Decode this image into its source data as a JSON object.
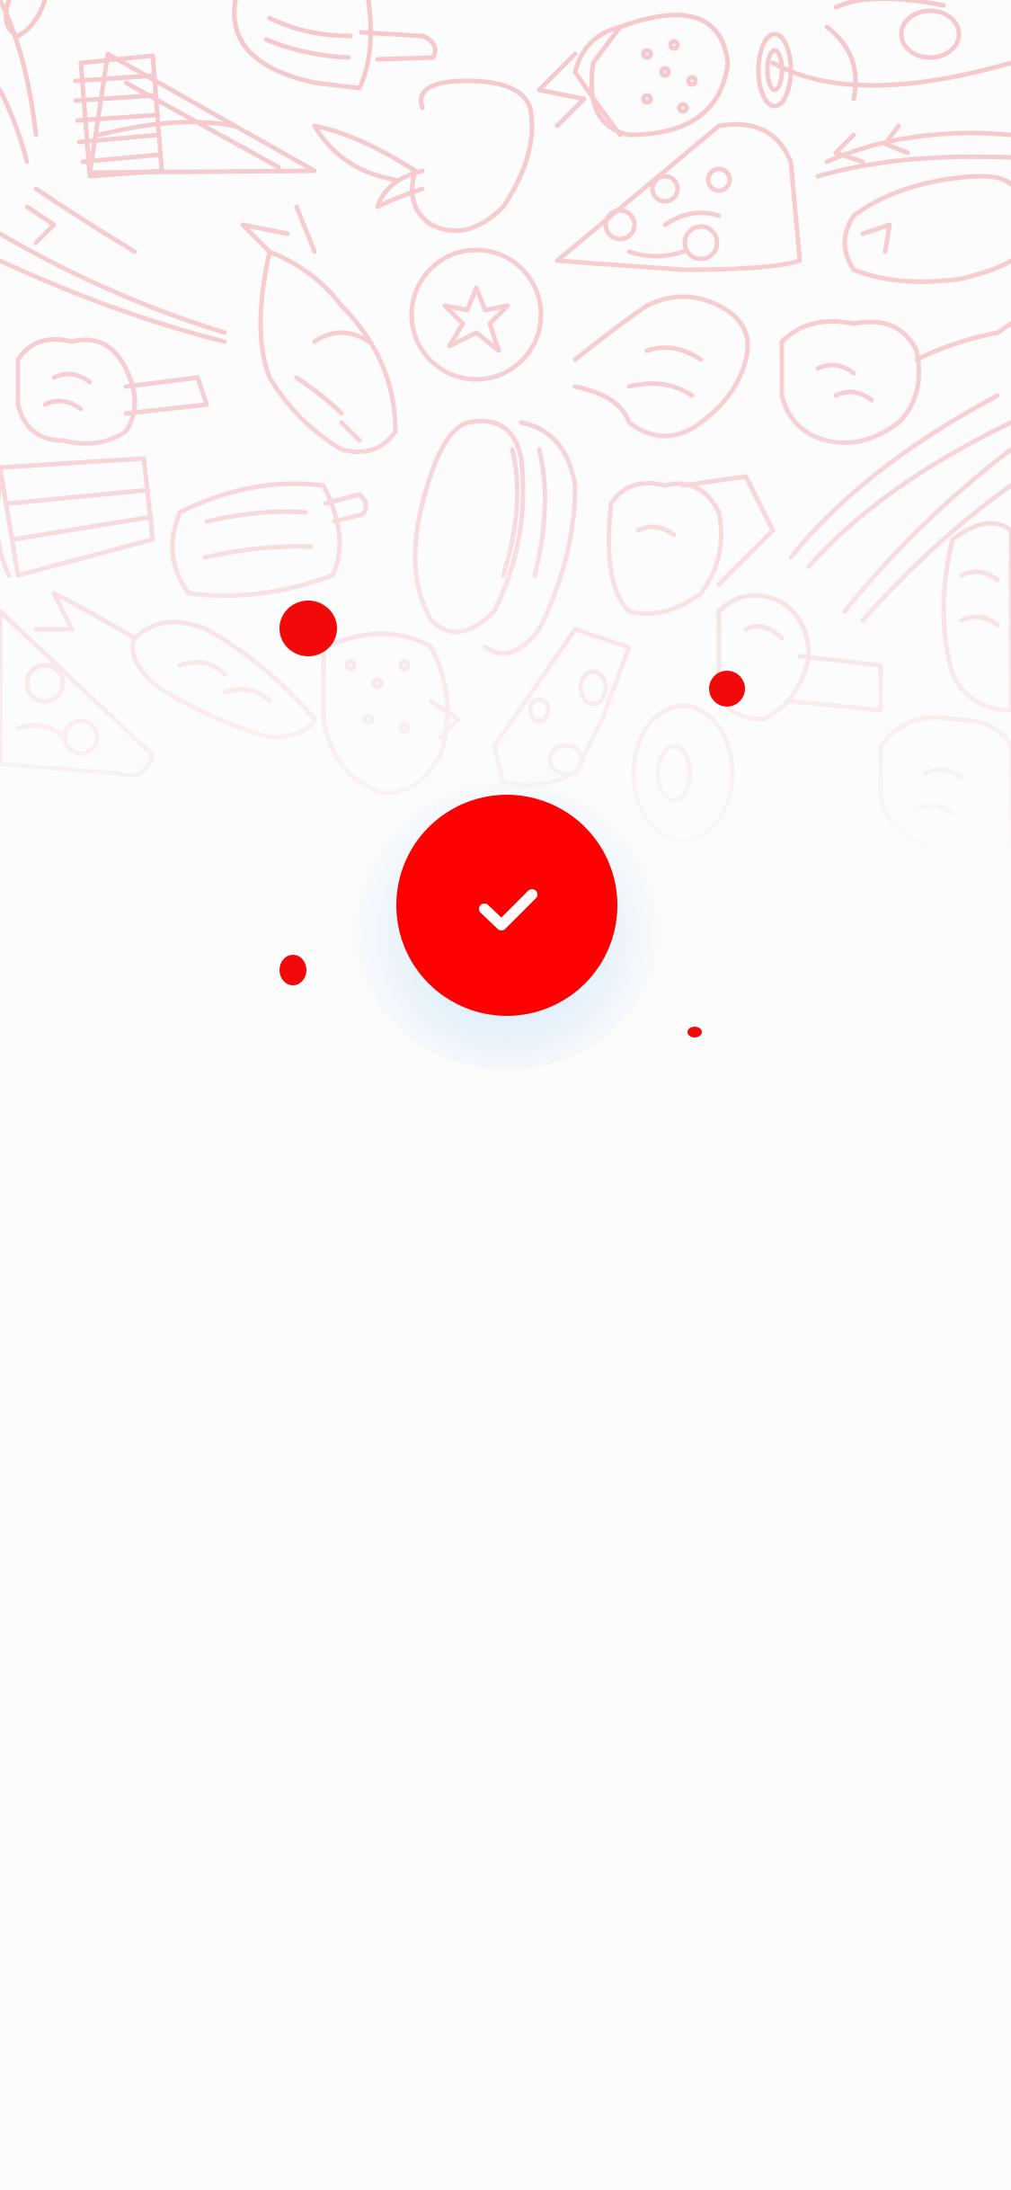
{
  "screen": {
    "name": "order-success",
    "background_color": "#fcfcfc"
  },
  "background_pattern": {
    "theme": "food doodles",
    "stroke_color": "#f6c9cc",
    "items": [
      "ice-cream-bar-icon",
      "french-fries-icon",
      "cake-slice-icon",
      "strawberry-icon",
      "sausage-icon",
      "apple-icon",
      "pizza-slice-icon",
      "fish-icon",
      "tomato-icon",
      "chicken-leg-icon",
      "broccoli-icon",
      "asparagus-icon",
      "burger-icon",
      "carrot-icon",
      "cheese-icon",
      "donut-icon",
      "cupcake-icon",
      "corn-icon"
    ]
  },
  "success_indicator": {
    "icon": "checkmark-icon",
    "badge_color": "#ff0000",
    "check_color": "#ffffff",
    "glow_color": "#bcdcf5"
  },
  "confetti": {
    "color": "#f20a0a",
    "count": 4
  }
}
